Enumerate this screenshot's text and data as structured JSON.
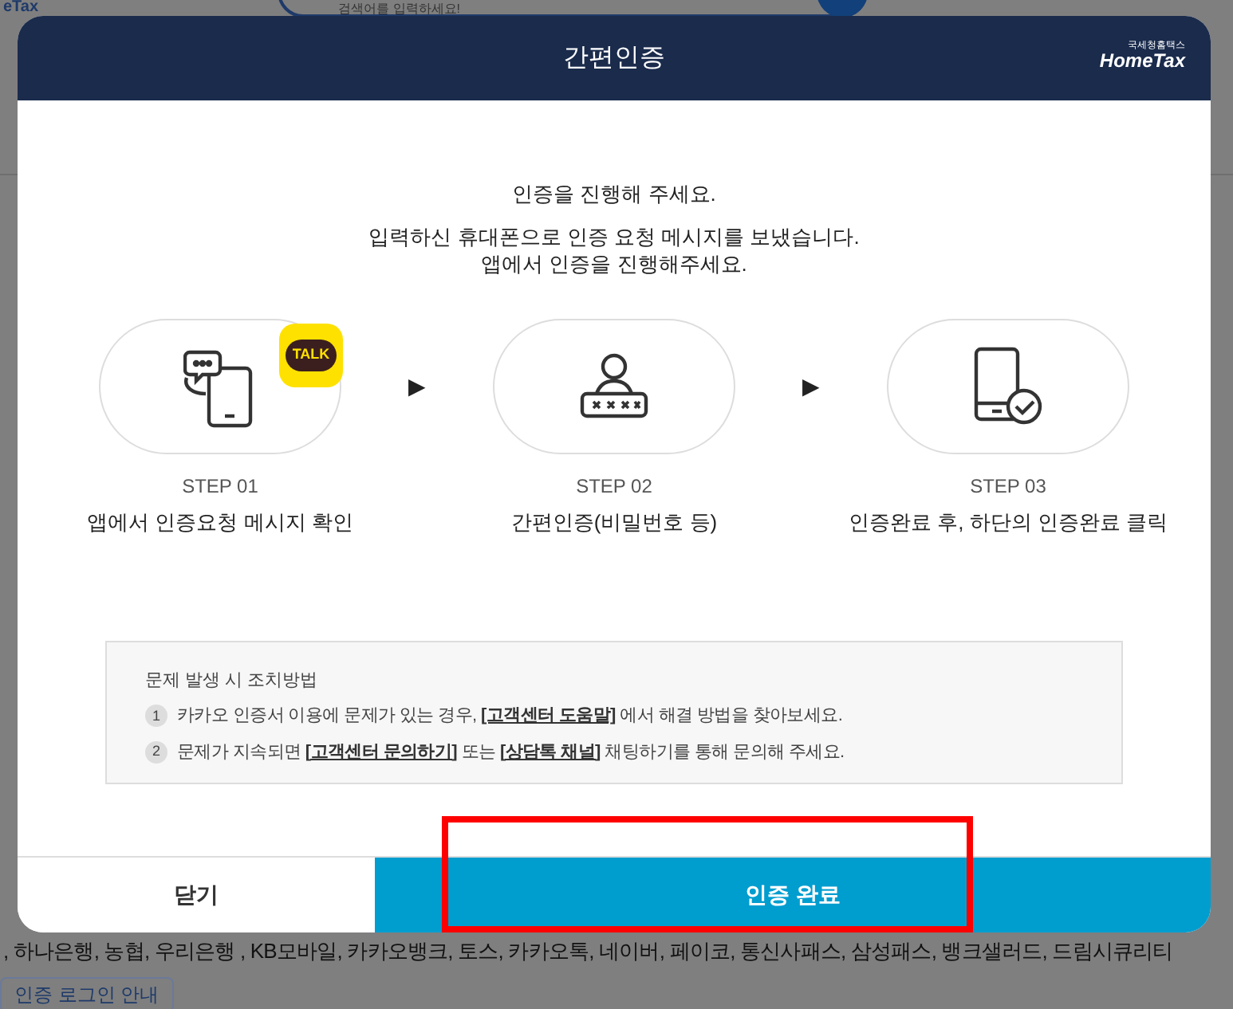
{
  "background_page": {
    "logo": "eTax",
    "search": {
      "placeholder": "검색어를 입력하세요!"
    },
    "provider_list": ", 하나은행, 농협, 우리은행 , KB모바일, 카카오뱅크, 토스, 카카오톡, 네이버, 페이코, 통신사패스, 삼성패스, 뱅크샐러드, 드림시큐리티",
    "guide_button": "인증 로그인 안내"
  },
  "dialog": {
    "title": "간편인증",
    "brand": {
      "small": "국세청홈택스",
      "name": "HomeTax"
    },
    "intro": [
      "인증을 진행해 주세요.",
      "입력하신 휴대폰으로 인증 요청 메시지를 보냈습니다.",
      "앱에서 인증을 진행해주세요."
    ],
    "steps": [
      {
        "kind": "message",
        "badge": "TALK",
        "step": "STEP 01",
        "caption": "앱에서 인증요청 메시지 확인"
      },
      {
        "kind": "password",
        "step": "STEP 02",
        "caption": "간편인증(비밀번호 등)"
      },
      {
        "kind": "done",
        "step": "STEP 03",
        "caption": "인증완료 후, 하단의 인증완료 클릭"
      }
    ],
    "arrows": [
      "▶",
      "▶"
    ],
    "help": {
      "title": "문제 발생 시 조치방법",
      "items": [
        {
          "number": "1",
          "parts": [
            {
              "kind": "text",
              "text": "카카오 인증서 이용에 문제가 있는 경우, "
            },
            {
              "kind": "link",
              "text": "[고객센터 도움말]"
            },
            {
              "kind": "text",
              "text": " 에서 해결 방법을 찾아보세요."
            }
          ]
        },
        {
          "number": "2",
          "parts": [
            {
              "kind": "text",
              "text": "문제가 지속되면 "
            },
            {
              "kind": "link",
              "text": "[고객센터 문의하기]"
            },
            {
              "kind": "text",
              "text": " 또는 "
            },
            {
              "kind": "link",
              "text": "[상담톡 채널]"
            },
            {
              "kind": "text",
              "text": " 채팅하기를 통해 문의해 주세요."
            }
          ]
        }
      ]
    },
    "buttons": [
      {
        "kind": "secondary",
        "label": "닫기"
      },
      {
        "kind": "primary",
        "label": "인증 완료",
        "highlighted": true
      }
    ]
  }
}
